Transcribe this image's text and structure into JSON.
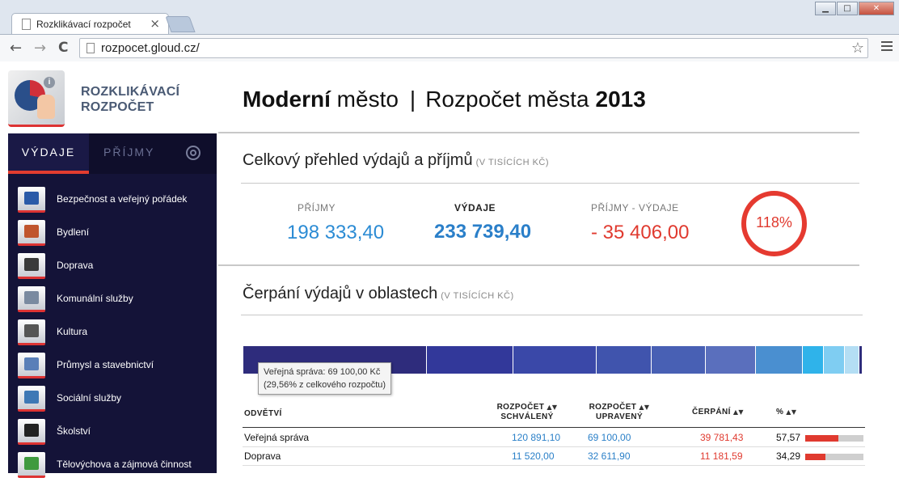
{
  "browser": {
    "tab_title": "Rozklikávací rozpočet",
    "url": "rozpocet.gloud.cz/",
    "close_glyph": "×",
    "back_glyph": "←",
    "forward_glyph": "→",
    "reload_glyph": "C",
    "star_glyph": "☆",
    "win_min": "▁",
    "win_max": "□",
    "win_close": "✕"
  },
  "brand": {
    "line1": "ROZKLIKÁVACÍ",
    "line2": "ROZPOČET",
    "logo_info": "i"
  },
  "header": {
    "city_bold": "Moderní",
    "city_rest": " město",
    "separator": "|",
    "budget_label": "Rozpočet města",
    "year": "2013"
  },
  "sidebar": {
    "tab_active": "VÝDAJE",
    "tab_inactive": "PŘÍJMY",
    "items": [
      {
        "label": "Bezpečnost a veřejný pořádek",
        "icon": "police-icon",
        "color": "#2a5aa8"
      },
      {
        "label": "Bydlení",
        "icon": "house-icon",
        "color": "#c0552d"
      },
      {
        "label": "Doprava",
        "icon": "traffic-light-icon",
        "color": "#3a3a3a"
      },
      {
        "label": "Komunální služby",
        "icon": "bin-icon",
        "color": "#7a8aa0"
      },
      {
        "label": "Kultura",
        "icon": "theatre-masks-icon",
        "color": "#555555"
      },
      {
        "label": "Průmysl a stavebnictví",
        "icon": "building-icon",
        "color": "#5a7fb8"
      },
      {
        "label": "Sociální služby",
        "icon": "people-icon",
        "color": "#3e78b5"
      },
      {
        "label": "Školství",
        "icon": "graduation-cap-icon",
        "color": "#222222"
      },
      {
        "label": "Tělovýchova a zájmová činnost",
        "icon": "sport-icon",
        "color": "#3f9a3f"
      }
    ]
  },
  "overview": {
    "title": "Celkový přehled výdajů a příjmů",
    "unit": "(V TISÍCÍCH KČ)",
    "income_label": "PŘÍJMY",
    "income_value": "198 333,40",
    "expense_label": "VÝDAJE",
    "expense_value": "233 739,40",
    "diff_label": "PŘÍJMY - VÝDAJE",
    "diff_value": "-  35 406,00",
    "ratio": "118%"
  },
  "areas": {
    "title": "Čerpání výdajů v oblastech",
    "unit": "(V TISÍCÍCH KČ)",
    "segments": [
      {
        "name": "Veřejná správa",
        "share": 29.56,
        "color": "#2e2c7c"
      },
      {
        "name": "segment-2",
        "share": 13.94,
        "color": "#32389a"
      },
      {
        "name": "segment-3",
        "share": 13.43,
        "color": "#3a48a8"
      },
      {
        "name": "segment-4",
        "share": 8.87,
        "color": "#4054ad"
      },
      {
        "name": "segment-5",
        "share": 8.61,
        "color": "#4860b4"
      },
      {
        "name": "segment-6",
        "share": 8.09,
        "color": "#5a6fbd"
      },
      {
        "name": "segment-7",
        "share": 7.57,
        "color": "#4a8fd0"
      },
      {
        "name": "segment-8",
        "share": 3.39,
        "color": "#2fb3ea"
      },
      {
        "name": "segment-9",
        "share": 3.39,
        "color": "#7fcdf2"
      },
      {
        "name": "segment-10",
        "share": 2.35,
        "color": "#b4def4"
      },
      {
        "name": "segment-11",
        "share": 0.52,
        "color": "#2e2c7c"
      }
    ],
    "tooltip_line1": "Veřejná správa: 69 100,00 Kč",
    "tooltip_line2": "(29,56% z celkového rozpočtu)"
  },
  "table": {
    "col_sector": "ODVĚTVÍ",
    "col_approved_1": "ROZPOČET",
    "col_approved_2": "SCHVÁLENÝ",
    "col_adjusted_1": "ROZPOČET",
    "col_adjusted_2": "UPRAVENÝ",
    "col_spent": "ČERPÁNÍ",
    "col_pct": "%",
    "sort_glyph": "▲▼",
    "rows": [
      {
        "sector": "Veřejná správa",
        "approved": "120 891,10",
        "adjusted": "69 100,00",
        "spent": "39 781,43",
        "pct": "57,57",
        "pct_value": 57.57
      },
      {
        "sector": "Doprava",
        "approved": "11 520,00",
        "adjusted": "32 611,90",
        "spent": "11 181,59",
        "pct": "34,29",
        "pct_value": 34.29
      }
    ]
  }
}
